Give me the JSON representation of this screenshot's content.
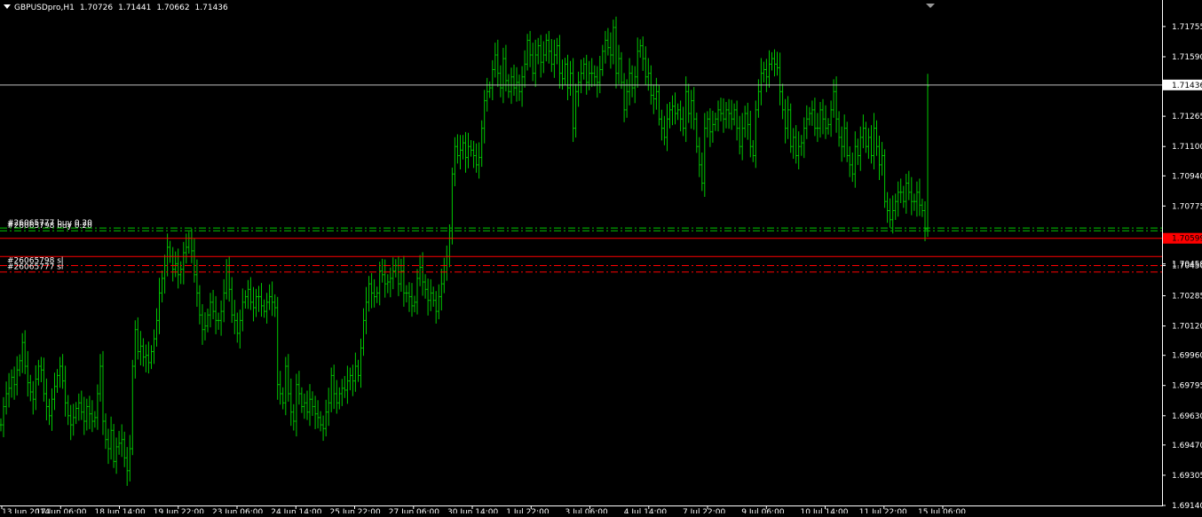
{
  "header": {
    "symbol": "GBPUSDpro,H1",
    "open": "1.70726",
    "high": "1.71441",
    "low": "1.70662",
    "close": "1.71436"
  },
  "colors": {
    "background": "#000000",
    "candle": "#00c800",
    "axis": "#ffffff",
    "bid_line": "#c0c0c0",
    "price_line": "#ff0000",
    "tp_line": "#00c800",
    "sl_line": "#ff0000",
    "price_tag": "#ff0000"
  },
  "chart_data": {
    "type": "bar",
    "y_axis_ticks": [
      "1.71755",
      "1.71590",
      "1.71436",
      "1.71265",
      "1.71100",
      "1.70940",
      "1.70775",
      "1.70599",
      "1.70459",
      "1.70450",
      "1.70285",
      "1.70120",
      "1.69960",
      "1.69795",
      "1.69630",
      "1.69470",
      "1.69305",
      "1.69140"
    ],
    "x_axis_ticks": [
      "13 Jun 2014",
      "17 Jun 06:00",
      "18 Jun 14:00",
      "19 Jun 22:00",
      "23 Jun 06:00",
      "24 Jun 14:00",
      "25 Jun 22:00",
      "27 Jun 06:00",
      "30 Jun 14:00",
      "1 Jul 22:00",
      "3 Jul 06:00",
      "4 Jul 14:00",
      "7 Jul 22:00",
      "9 Jul 06:00",
      "10 Jul 14:00",
      "11 Jul 22:00",
      "15 Jul 06:00"
    ],
    "ylim": [
      1.6914,
      1.719
    ],
    "bid_price": "1.71436",
    "levels": [
      {
        "label": "#26065798 buy 0.20",
        "price": 1.7064,
        "style": "dashdot",
        "color": "#00c800"
      },
      {
        "label": "#26065777 buy 0.20",
        "price": 1.70655,
        "style": "dashdot",
        "color": "#00c800"
      },
      {
        "label": "",
        "price": 1.70599,
        "style": "solid",
        "color": "#ff0000",
        "tag": "1.70599"
      },
      {
        "label": "",
        "price": 1.70499,
        "style": "solid",
        "color": "#ff0000",
        "tag": "1.70499"
      },
      {
        "label": "#26065798 sl",
        "price": 1.7045,
        "style": "dashdot",
        "color": "#ff0000"
      },
      {
        "label": "#26065777 sl",
        "price": 1.70415,
        "style": "dashdot",
        "color": "#ff0000"
      }
    ],
    "closes": [
      1.6958,
      1.6968,
      1.6975,
      1.6978,
      1.6984,
      1.698,
      1.6988,
      1.6993,
      1.7003,
      1.699,
      1.6981,
      1.6976,
      1.6972,
      1.6983,
      1.699,
      1.6988,
      1.6975,
      1.6968,
      1.6963,
      1.6972,
      1.6979,
      1.6985,
      1.699,
      1.6982,
      1.697,
      1.6963,
      1.6958,
      1.6962,
      1.6967,
      1.697,
      1.6965,
      1.696,
      1.6968,
      1.6964,
      1.696,
      1.6962,
      1.6975,
      1.699,
      1.696,
      1.695,
      1.6945,
      1.6955,
      1.6938,
      1.6946,
      1.6948,
      1.695,
      1.694,
      1.6933,
      1.6945,
      1.699,
      1.701,
      1.6998,
      1.7001,
      1.6995,
      1.6996,
      1.6992,
      1.6998,
      1.7005,
      1.7015,
      1.703,
      1.7038,
      1.7045,
      1.7055,
      1.705,
      1.7043,
      1.7046,
      1.704,
      1.7043,
      1.7052,
      1.7055,
      1.706,
      1.7053,
      1.704,
      1.703,
      1.7018,
      1.701,
      1.7012,
      1.7018,
      1.7025,
      1.702,
      1.7015,
      1.7015,
      1.702,
      1.703,
      1.7045,
      1.7032,
      1.7018,
      1.7015,
      1.7008,
      1.7015,
      1.7025,
      1.7028,
      1.7032,
      1.7025,
      1.7022,
      1.7028,
      1.7028,
      1.7023,
      1.702,
      1.7025,
      1.7028,
      1.7025,
      1.7022,
      1.698,
      1.6975,
      1.697,
      1.699,
      1.6975,
      1.6965,
      1.696,
      1.698,
      1.6975,
      1.6968,
      1.697,
      1.6965,
      1.6972,
      1.6968,
      1.6964,
      1.6962,
      1.6958,
      1.6956,
      1.6965,
      1.697,
      1.6985,
      1.6975,
      1.697,
      1.6975,
      1.6978,
      1.6977,
      1.6982,
      1.6985,
      1.6982,
      1.699,
      1.6985,
      1.7,
      1.7015,
      1.7025,
      1.7035,
      1.703,
      1.7028,
      1.703,
      1.7042,
      1.704,
      1.7035,
      1.7036,
      1.7038,
      1.7042,
      1.7045,
      1.7035,
      1.7042,
      1.703,
      1.703,
      1.7028,
      1.7023,
      1.7025,
      1.7038,
      1.7044,
      1.7036,
      1.7032,
      1.7026,
      1.703,
      1.7026,
      1.702,
      1.7028,
      1.7035,
      1.7045,
      1.705,
      1.706,
      1.7095,
      1.711,
      1.7105,
      1.7108,
      1.7112,
      1.7104,
      1.711,
      1.7108,
      1.7105,
      1.71,
      1.7104,
      1.712,
      1.7135,
      1.714,
      1.7142,
      1.7152,
      1.716,
      1.715,
      1.7142,
      1.7158,
      1.7146,
      1.714,
      1.7148,
      1.7142,
      1.7145,
      1.714,
      1.7148,
      1.7155,
      1.7168,
      1.716,
      1.715,
      1.716,
      1.7165,
      1.7156,
      1.716,
      1.7168,
      1.7162,
      1.7155,
      1.716,
      1.7165,
      1.715,
      1.7147,
      1.7155,
      1.7142,
      1.715,
      1.712,
      1.714,
      1.7145,
      1.715,
      1.7155,
      1.7145,
      1.715,
      1.715,
      1.7148,
      1.7145,
      1.7152,
      1.7162,
      1.7168,
      1.7164,
      1.716,
      1.7175,
      1.715,
      1.7158,
      1.7145,
      1.713,
      1.714,
      1.715,
      1.7142,
      1.7148,
      1.7162,
      1.7165,
      1.7158,
      1.7148,
      1.715,
      1.7138,
      1.7136,
      1.714,
      1.7125,
      1.712,
      1.7115,
      1.7125,
      1.713,
      1.7132,
      1.7128,
      1.713,
      1.7125,
      1.712,
      1.714,
      1.7128,
      1.7135,
      1.7125,
      1.711,
      1.71,
      1.709,
      1.712,
      1.7125,
      1.7118,
      1.7122,
      1.7125,
      1.713,
      1.7128,
      1.7125,
      1.713,
      1.7128,
      1.7125,
      1.713,
      1.712,
      1.711,
      1.712,
      1.7128,
      1.7122,
      1.711,
      1.7105,
      1.713,
      1.714,
      1.715,
      1.7152,
      1.7148,
      1.7155,
      1.7158,
      1.7155,
      1.7153,
      1.714,
      1.713,
      1.712,
      1.713,
      1.711,
      1.7115,
      1.7105,
      1.711,
      1.7112,
      1.712,
      1.7125,
      1.7128,
      1.713,
      1.712,
      1.712,
      1.713,
      1.7125,
      1.712,
      1.7122,
      1.713,
      1.714,
      1.7125,
      1.7115,
      1.711,
      1.712,
      1.7105,
      1.71,
      1.7095,
      1.711,
      1.7105,
      1.7115,
      1.712,
      1.711,
      1.7115,
      1.7105,
      1.712,
      1.711,
      1.71,
      1.7105,
      1.708,
      1.7075,
      1.707,
      1.7075,
      1.708,
      1.7085,
      1.7085,
      1.708,
      1.709,
      1.7085,
      1.708,
      1.708,
      1.7085,
      1.7078,
      1.7075,
      1.7065,
      1.7143
    ]
  }
}
